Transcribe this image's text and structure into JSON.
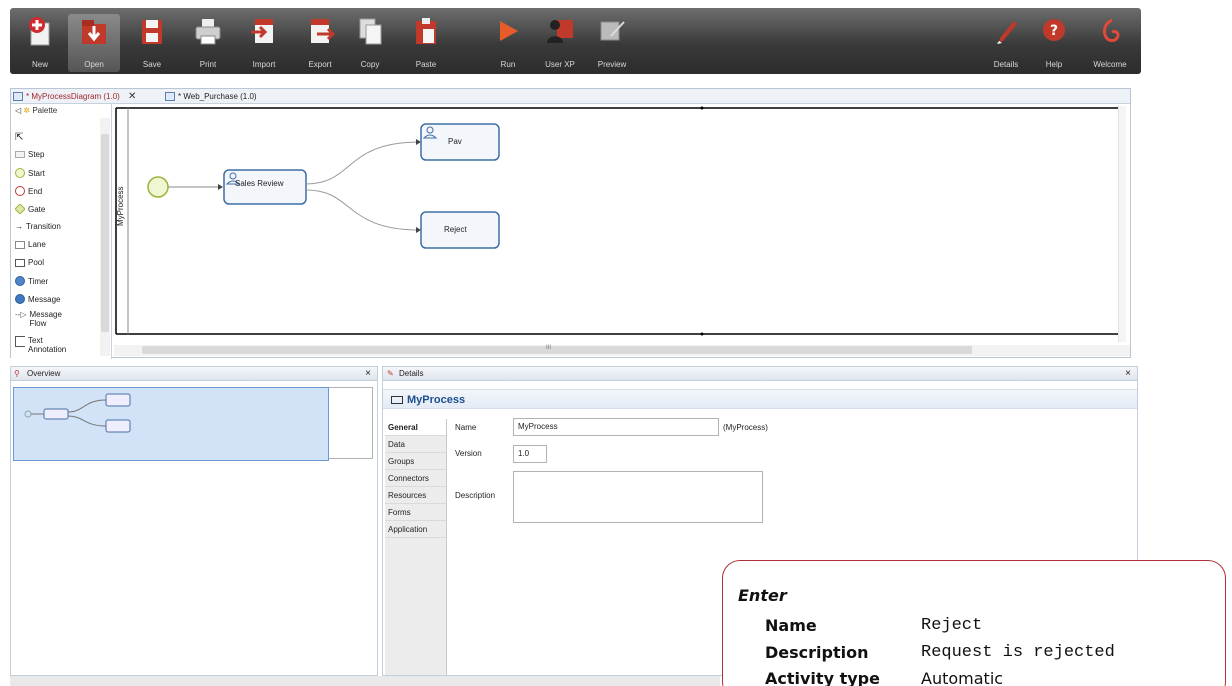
{
  "toolbar": {
    "buttons": [
      {
        "label": "New",
        "icon": "new-icon"
      },
      {
        "label": "Open",
        "icon": "open-icon"
      },
      {
        "label": "Save",
        "icon": "save-icon"
      },
      {
        "label": "Print",
        "icon": "print-icon"
      },
      {
        "label": "Import",
        "icon": "import-icon"
      },
      {
        "label": "Export",
        "icon": "export-icon"
      },
      {
        "label": "Copy",
        "icon": "copy-icon"
      },
      {
        "label": "Paste",
        "icon": "paste-icon"
      },
      {
        "label": "Run",
        "icon": "run-icon"
      },
      {
        "label": "User XP",
        "icon": "user-xp-icon"
      },
      {
        "label": "Preview",
        "icon": "preview-icon"
      },
      {
        "label": "Details",
        "icon": "details-icon"
      },
      {
        "label": "Help",
        "icon": "help-icon"
      },
      {
        "label": "Welcome",
        "icon": "welcome-icon"
      }
    ]
  },
  "editor": {
    "tabs": [
      {
        "label": "* MyProcessDiagram (1.0)",
        "close": "✕"
      },
      {
        "label": "* Web_Purchase (1.0)"
      }
    ]
  },
  "palette": {
    "title": "Palette",
    "items": [
      "Step",
      "Start",
      "End",
      "Gate",
      "Transition",
      "Lane",
      "Pool",
      "Timer",
      "Message",
      "Message",
      "Flow",
      "Text",
      "Annotation"
    ]
  },
  "diagram": {
    "pool_label": "MyProcess",
    "nodes": {
      "sales_review": "Sales Review",
      "pay": "Pav",
      "reject": "Reject"
    },
    "scroll_marker": "III"
  },
  "overview": {
    "title": "Overview",
    "close": "×"
  },
  "details": {
    "title": "Details",
    "close": "×",
    "process_title": "MyProcess",
    "side_tabs": [
      "General",
      "Data",
      "Groups",
      "Connectors",
      "Resources",
      "Forms",
      "Application"
    ],
    "fields": {
      "name_label": "Name",
      "name_value": "MyProcess",
      "name_hint": "(MyProcess)",
      "version_label": "Version",
      "version_value": "1.0",
      "description_label": "Description",
      "description_value": ""
    }
  },
  "callout": {
    "title": "Enter",
    "rows": [
      {
        "key": "Name",
        "value": "Reject"
      },
      {
        "key": "Description",
        "value": "Request is rejected"
      },
      {
        "key": "Activity type",
        "value": "Automatic"
      }
    ]
  }
}
